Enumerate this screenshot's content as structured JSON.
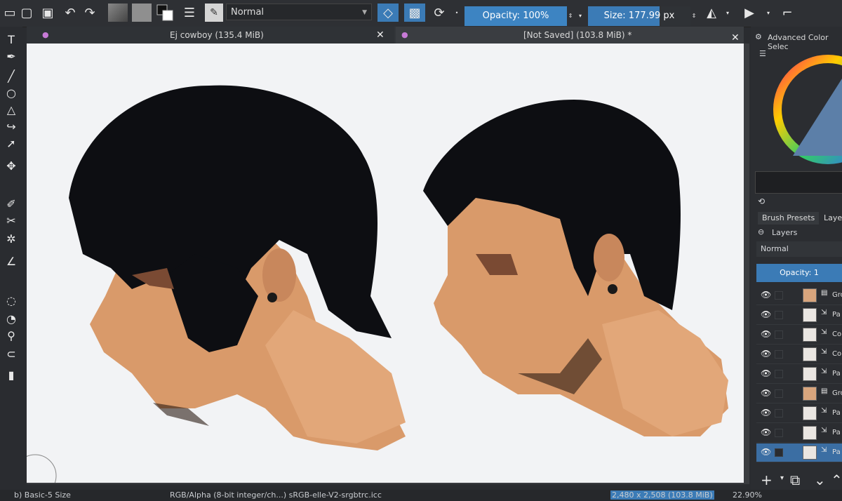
{
  "toolbar": {
    "blend_mode": "Normal",
    "opacity_label": "Opacity: 100%",
    "opacity_fraction": 1.0,
    "size_label": "Size: 177.99 px",
    "size_fraction": 0.7
  },
  "tabs": [
    {
      "label": "Ej cowboy (135.4 MiB)"
    },
    {
      "label": "[Not Saved]  (103.8 MiB) *"
    }
  ],
  "right_panel": {
    "color_title": "Advanced Color Selec",
    "brush_presets_tab": "Brush Presets",
    "layers_tab": "Layers",
    "layers_title": "Layers",
    "blend": "Normal",
    "opacity_label": "Opacity: 1",
    "layers": [
      {
        "name": "Group",
        "type": "group"
      },
      {
        "name": "Pa",
        "type": "paint"
      },
      {
        "name": "Co",
        "type": "paint"
      },
      {
        "name": "Co",
        "type": "paint"
      },
      {
        "name": "Pa",
        "type": "paint"
      },
      {
        "name": "Group",
        "type": "group"
      },
      {
        "name": "Pa",
        "type": "paint"
      },
      {
        "name": "Pa",
        "type": "paint"
      },
      {
        "name": "Pa",
        "type": "paint"
      }
    ]
  },
  "statusbar": {
    "brush": "b) Basic-5 Size",
    "color_space": "RGB/Alpha (8-bit integer/ch...)  sRGB-elle-V2-srgbtrc.icc",
    "dimensions": "2,480 x 2,508 (103.8 MiB)",
    "zoom": "22.90%"
  },
  "colors": {
    "accent": "#3b7bb6",
    "background": "#2a2c30",
    "canvas": "#f2f3f5",
    "skin": "#d99a6a",
    "hair": "#0d0e12"
  }
}
